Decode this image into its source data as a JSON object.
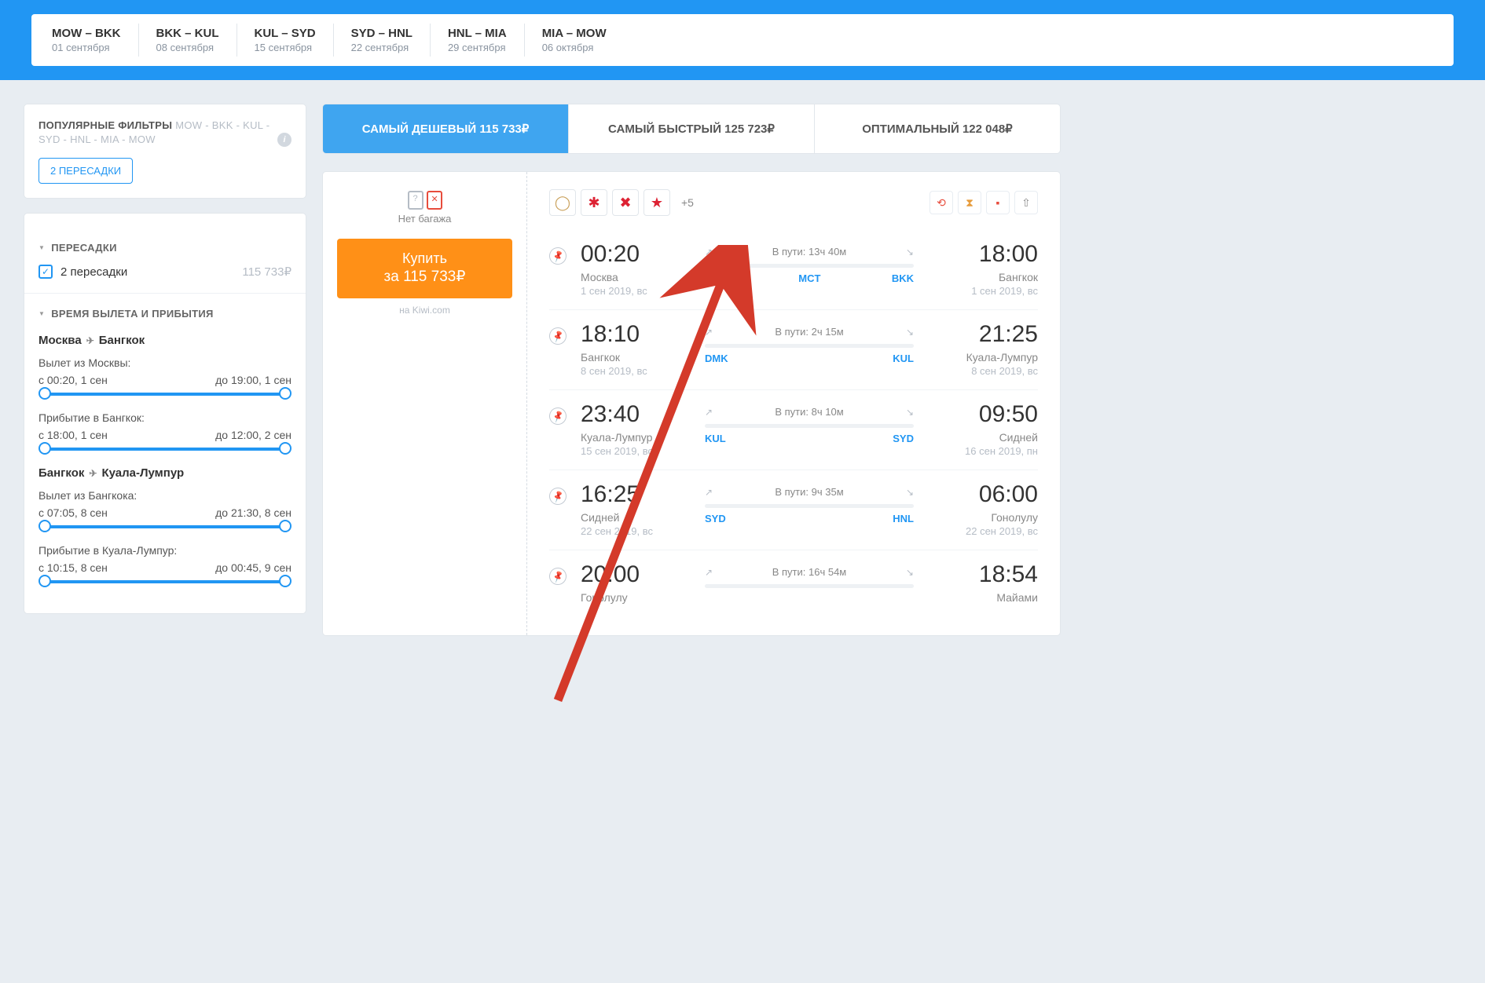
{
  "route_chips": [
    {
      "route": "MOW – BKK",
      "date": "01 сентября"
    },
    {
      "route": "BKK – KUL",
      "date": "08 сентября"
    },
    {
      "route": "KUL – SYD",
      "date": "15 сентября"
    },
    {
      "route": "SYD – HNL",
      "date": "22 сентября"
    },
    {
      "route": "HNL – MIA",
      "date": "29 сентября"
    },
    {
      "route": "MIA – MOW",
      "date": "06 октября"
    }
  ],
  "popular_filters": {
    "title": "ПОПУЛЯРНЫЕ ФИЛЬТРЫ",
    "route_mute": "MOW - BKK - KUL - SYD - HNL - MIA - MOW",
    "pill": "2 ПЕРЕСАДКИ"
  },
  "transfers": {
    "title": "ПЕРЕСАДКИ",
    "item_label": "2 пересадки",
    "item_price": "115 733₽"
  },
  "time_filter": {
    "title": "ВРЕМЯ ВЫЛЕТА И ПРИБЫТИЯ",
    "routes": [
      {
        "from": "Москва",
        "to": "Бангкок",
        "dep_label": "Вылет из Москвы:",
        "dep_from": "с 00:20, 1 сен",
        "dep_to": "до 19:00, 1 сен",
        "arr_label": "Прибытие в Бангкок:",
        "arr_from": "с 18:00, 1 сен",
        "arr_to": "до 12:00, 2 сен"
      },
      {
        "from": "Бангкок",
        "to": "Куала-Лумпур",
        "dep_label": "Вылет из Бангкока:",
        "dep_from": "с 07:05, 8 сен",
        "dep_to": "до 21:30, 8 сен",
        "arr_label": "Прибытие в Куала-Лумпур:",
        "arr_from": "с 10:15, 8 сен",
        "arr_to": "до 00:45, 9 сен"
      }
    ]
  },
  "tabs": {
    "cheapest": "САМЫЙ ДЕШЕВЫЙ  115 733₽",
    "fastest": "САМЫЙ БЫСТРЫЙ  125 723₽",
    "optimal": "ОПТИМАЛЬНЫЙ  122 048₽"
  },
  "ticket": {
    "baggage_text": "Нет багажа",
    "buy_line1": "Купить",
    "buy_line2": "за 115 733₽",
    "vendor": "на Kiwi.com",
    "more_airlines": "+5",
    "segments": [
      {
        "dep_time": "00:20",
        "dep_city": "Москва",
        "dep_date": "1 сен 2019, вс",
        "duration": "В пути: 13ч 40м",
        "arr_time": "18:00",
        "arr_city": "Бангкок",
        "arr_date": "1 сен 2019, вс",
        "code_from": "DME",
        "code_mid": "MCT",
        "code_to": "BKK"
      },
      {
        "dep_time": "18:10",
        "dep_city": "Бангкок",
        "dep_date": "8 сен 2019, вс",
        "duration": "В пути: 2ч 15м",
        "arr_time": "21:25",
        "arr_city": "Куала-Лумпур",
        "arr_date": "8 сен 2019, вс",
        "code_from": "DMK",
        "code_mid": "",
        "code_to": "KUL"
      },
      {
        "dep_time": "23:40",
        "dep_city": "Куала-Лумпур",
        "dep_date": "15 сен 2019, вс",
        "duration": "В пути: 8ч 10м",
        "arr_time": "09:50",
        "arr_city": "Сидней",
        "arr_date": "16 сен 2019, пн",
        "code_from": "KUL",
        "code_mid": "",
        "code_to": "SYD"
      },
      {
        "dep_time": "16:25",
        "dep_city": "Сидней",
        "dep_date": "22 сен 2019, вс",
        "duration": "В пути: 9ч 35м",
        "arr_time": "06:00",
        "arr_city": "Гонолулу",
        "arr_date": "22 сен 2019, вс",
        "code_from": "SYD",
        "code_mid": "",
        "code_to": "HNL"
      },
      {
        "dep_time": "20:00",
        "dep_city": "Гонолулу",
        "dep_date": "",
        "duration": "В пути: 16ч 54м",
        "arr_time": "18:54",
        "arr_city": "Майами",
        "arr_date": "",
        "code_from": "",
        "code_mid": "",
        "code_to": ""
      }
    ]
  }
}
